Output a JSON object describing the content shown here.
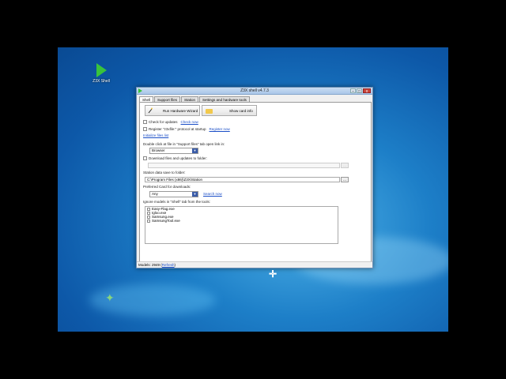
{
  "desktop": {
    "icon_label": "Z3X Shell"
  },
  "window": {
    "title": "Z3X shell v4.7.3",
    "min": "–",
    "max": "□",
    "close": "x"
  },
  "tabs": [
    "Shell",
    "Support files",
    "Station",
    "Settings and hardware tools"
  ],
  "shell": {
    "run_wizard": "Run Hardware Wizard",
    "show_card_info": "Show card info",
    "check_updates": "Check for updates",
    "check_now": "Check now",
    "register_protocol": "Register \"z3xfile:\" protocol at startup",
    "register_now": "Register now",
    "initialize_files": "Initialize files list",
    "double_click_label": "Double click at file in \"Support files\" tab open link in:",
    "browser_value": "Browser",
    "download_files": "Download files and updates to folder:",
    "station_folder_label": "Station data save to folder:",
    "station_folder_value": "C:\\Program Files (x86)\\Z3X\\Station",
    "preferred_card_label": "Preferred Card for downloads:",
    "card_value": "Any",
    "search_now": "Search now",
    "ignore_label": "Ignore models in \"Shell\" tab from the tools:",
    "ignore_items": [
      "Easy-Flag.exe",
      "Igloo.exe",
      "Samsung.exe",
      "SamsungTool.exe"
    ],
    "ellipsis": "..."
  },
  "status": {
    "models": "Models: 2949",
    "refresh": "Refresh"
  }
}
